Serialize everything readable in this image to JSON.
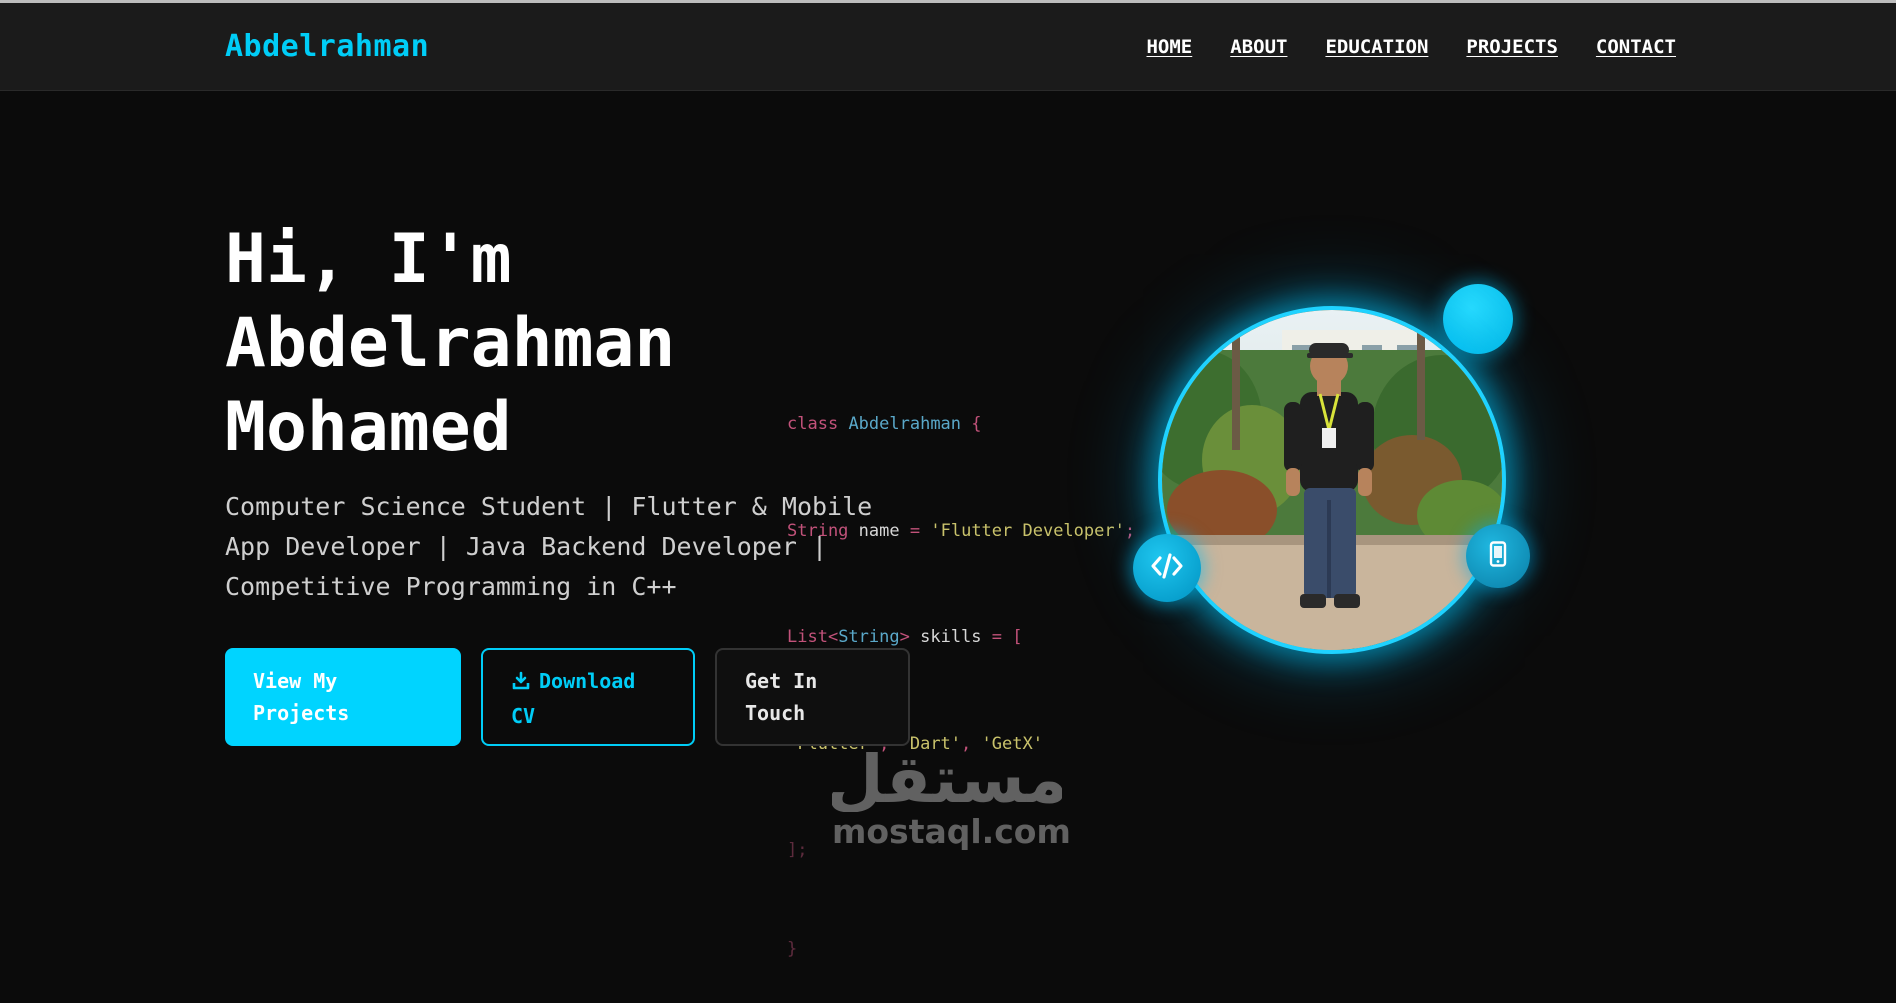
{
  "nav": {
    "brand": "Abdelrahman",
    "links": [
      "HOME",
      "ABOUT",
      "EDUCATION",
      "PROJECTS",
      "CONTACT"
    ]
  },
  "hero": {
    "title_lines": [
      "Hi, I'm",
      "Abdelrahman",
      "Mohamed"
    ],
    "subtitle": "Computer Science Student | Flutter & Mobile App Developer | Java Backend Developer | Competitive Programming in C++"
  },
  "code": {
    "line1_kw": "class",
    "line1_cls": "Abdelrahman",
    "line1_brace": "{",
    "line2_type": "String",
    "line2_var": "name",
    "line2_eq": "=",
    "line2_str": "'Flutter Developer'",
    "line2_end": ";",
    "line3_type": "List<",
    "line3_cls": "String",
    "line3_close": ">",
    "line3_var": "skills",
    "line3_eq": "= [",
    "line4_s1": "'Flutter'",
    "line4_s2": "'Dart'",
    "line4_s3": "'GetX'",
    "line4_sep": ", ",
    "line5": "];",
    "line6": "}"
  },
  "buttons": {
    "projects_label": "View My Projects",
    "cv_label": "Download CV",
    "contact_label": "Get In Touch"
  },
  "watermark": {
    "arabic": "مستقل",
    "latin": "mostaql.com"
  },
  "icons": {
    "download": "download-icon",
    "code": "code-icon",
    "phone": "mobile-phone-icon",
    "profile": "profile-photo"
  },
  "colors": {
    "accent": "#00cdf7",
    "background": "#0b0b0b",
    "navbar": "#1b1b1b"
  }
}
